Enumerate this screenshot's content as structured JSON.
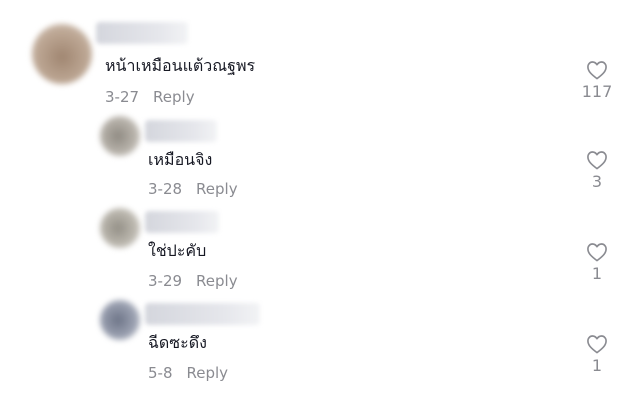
{
  "comments": [
    {
      "text": "หน้าเหมือนแต้วณฐพร",
      "date": "3-27",
      "reply_label": "Reply",
      "likes": "117",
      "avatar_color": "#b29a85"
    },
    {
      "text": "เหมือนจิง",
      "date": "3-28",
      "reply_label": "Reply",
      "likes": "3",
      "avatar_color": "#a7a29a"
    },
    {
      "text": "ใช่ปะคับ",
      "date": "3-29",
      "reply_label": "Reply",
      "likes": "1",
      "avatar_color": "#aaa79f"
    },
    {
      "text": "ฉีดซะดึง",
      "date": "5-8",
      "reply_label": "Reply",
      "likes": "1",
      "avatar_color": "#8e95a6"
    }
  ]
}
